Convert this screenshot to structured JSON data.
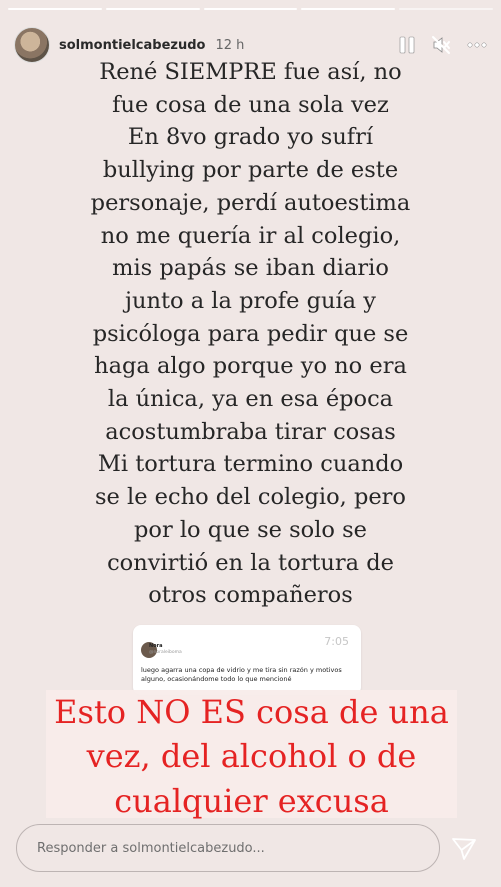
{
  "header": {
    "username": "solmontielcabezudo",
    "time": "12 h",
    "icons": [
      "pause-icon",
      "mute-icon",
      "more-options-icon"
    ]
  },
  "story_lines": [
    "René SIEMPRE fue así, no",
    "fue cosa de una sola vez",
    "En 8vo grado yo sufrí",
    "bullying por parte de este",
    "personaje, perdí autoestima",
    "no me quería ir al colegio,",
    "mis papás se iban diario",
    "junto a la profe guía y",
    "psicóloga para pedir que se",
    "haga algo porque yo no era",
    "la única, ya en esa época",
    "acostumbraba tirar cosas",
    "Mi tortura termino cuando",
    "se le echo del colegio, pero",
    "por lo que se solo se",
    "convirtió en la tortura de",
    "otros compañeros"
  ],
  "tweet": {
    "name": "Nora",
    "handle": "@noraleiboma",
    "time": "7:05",
    "body": "luego agarra una copa de vidrio y me tira sin razón y motivos alguno, ocasionándome todo lo que mencioné"
  },
  "highlight_lines": [
    "Esto NO ES cosa de una",
    "vez, del alcohol o de",
    "cualquier excusa"
  ],
  "reply": {
    "placeholder": "Responder a solmontielcabezudo..."
  },
  "colors": {
    "background": "#f0e7e5",
    "highlight_text": "#e52323"
  }
}
